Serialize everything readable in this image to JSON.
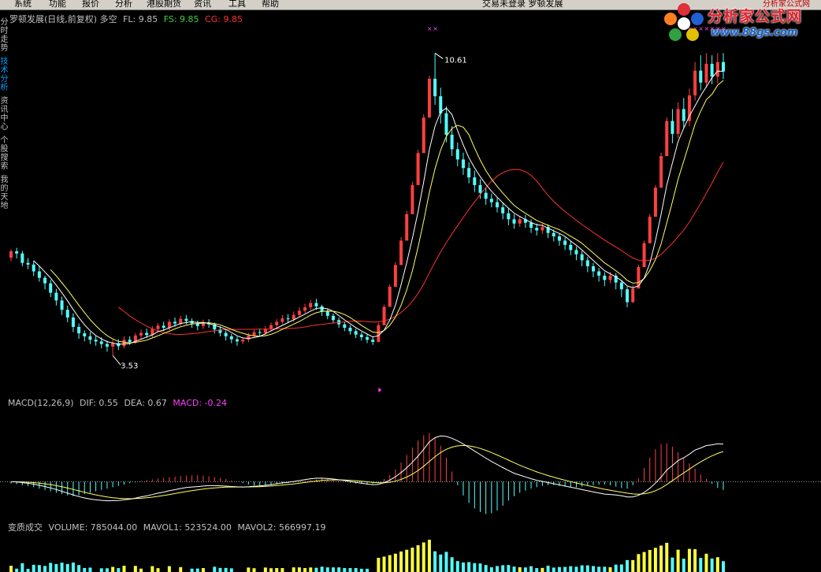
{
  "menubar": {
    "items": [
      "系统",
      "功能",
      "报价",
      "分析",
      "港股期货",
      "资讯",
      "工具",
      "帮助"
    ],
    "right_text": "交易未登录  罗顿发展",
    "right_red": "分析家公式网"
  },
  "sidebar": {
    "items": [
      {
        "label": "分时走势",
        "active": false
      },
      {
        "label": "技术分析",
        "active": true
      },
      {
        "label": "资讯中心",
        "active": false
      },
      {
        "label": "个股搜索",
        "active": false
      },
      {
        "label": "我的天地",
        "active": false
      }
    ]
  },
  "price_header": {
    "title": "罗顿发展(日线,前复权) 多空",
    "fl": "FL: 9.85",
    "fs": "FS: 9.85",
    "cg": "CG: 9.85",
    "colors": {
      "fl": "#c0c0c0",
      "fs": "#40d040",
      "cg": "#ff3030"
    }
  },
  "macd_header": {
    "name": "MACD(12,26,9)",
    "dif": "DIF: 0.55",
    "dea": "DEA: 0.67",
    "macd": "MACD: -0.24",
    "colors": {
      "macd": "#ff40ff"
    }
  },
  "volume_header": {
    "name": "变质成交",
    "volume": "VOLUME: 785044.00",
    "mavol1": "MAVOL1: 523524.00",
    "mavol2": "MAVOL2: 566997.19"
  },
  "logo": {
    "title": "分析家公式网",
    "url": "www.88gs.com"
  },
  "annotations": {
    "high": "10.61",
    "low": "3.53"
  },
  "chart_data": {
    "type": "candlestick",
    "price": {
      "ymin": 3.0,
      "ymax": 11.3,
      "high_marker": 10.61,
      "low_marker": 3.53,
      "candles": [
        [
          5.82,
          5.97,
          6.01,
          5.74
        ],
        [
          5.97,
          5.92,
          6.05,
          5.8
        ],
        [
          5.92,
          5.7,
          5.98,
          5.62
        ],
        [
          5.7,
          5.66,
          5.81,
          5.55
        ],
        [
          5.66,
          5.5,
          5.75,
          5.39
        ],
        [
          5.5,
          5.35,
          5.62,
          5.26
        ],
        [
          5.35,
          5.22,
          5.4,
          5.08
        ],
        [
          5.22,
          5.0,
          5.3,
          4.9
        ],
        [
          5.0,
          4.82,
          5.09,
          4.7
        ],
        [
          4.82,
          4.6,
          4.91,
          4.48
        ],
        [
          4.6,
          4.42,
          4.7,
          4.31
        ],
        [
          4.42,
          4.2,
          4.52,
          4.08
        ],
        [
          4.2,
          4.05,
          4.28,
          3.92
        ],
        [
          4.05,
          3.98,
          4.12,
          3.86
        ],
        [
          3.98,
          3.9,
          4.08,
          3.8
        ],
        [
          3.9,
          3.86,
          3.99,
          3.76
        ],
        [
          3.86,
          3.8,
          3.96,
          3.7
        ],
        [
          3.8,
          3.74,
          3.88,
          3.62
        ],
        [
          3.74,
          3.82,
          3.9,
          3.53
        ],
        [
          3.82,
          3.75,
          3.91,
          3.66
        ],
        [
          3.75,
          3.9,
          3.98,
          3.7
        ],
        [
          3.9,
          3.85,
          3.98,
          3.78
        ],
        [
          3.85,
          4.0,
          4.06,
          3.8
        ],
        [
          4.0,
          4.06,
          4.14,
          3.92
        ],
        [
          4.06,
          4.01,
          4.16,
          3.94
        ],
        [
          4.01,
          4.15,
          4.22,
          3.96
        ],
        [
          4.15,
          4.23,
          4.29,
          4.08
        ],
        [
          4.23,
          4.18,
          4.32,
          4.1
        ],
        [
          4.18,
          4.32,
          4.38,
          4.12
        ],
        [
          4.32,
          4.28,
          4.42,
          4.2
        ],
        [
          4.28,
          4.39,
          4.46,
          4.22
        ],
        [
          4.39,
          4.34,
          4.48,
          4.26
        ],
        [
          4.34,
          4.28,
          4.4,
          4.18
        ],
        [
          4.28,
          4.22,
          4.35,
          4.12
        ],
        [
          4.22,
          4.3,
          4.37,
          4.15
        ],
        [
          4.3,
          4.26,
          4.38,
          4.18
        ],
        [
          4.26,
          4.14,
          4.3,
          4.05
        ],
        [
          4.14,
          4.06,
          4.22,
          3.98
        ],
        [
          4.06,
          3.98,
          4.12,
          3.88
        ],
        [
          3.98,
          3.91,
          4.04,
          3.82
        ],
        [
          3.91,
          3.86,
          3.97,
          3.76
        ],
        [
          3.86,
          3.9,
          3.96,
          3.8
        ],
        [
          3.9,
          4.0,
          4.06,
          3.84
        ],
        [
          4.0,
          4.08,
          4.14,
          3.94
        ],
        [
          4.08,
          4.06,
          4.16,
          3.98
        ],
        [
          4.06,
          4.16,
          4.22,
          4.0
        ],
        [
          4.16,
          4.24,
          4.3,
          4.1
        ],
        [
          4.24,
          4.32,
          4.38,
          4.16
        ],
        [
          4.32,
          4.4,
          4.48,
          4.26
        ],
        [
          4.4,
          4.38,
          4.5,
          4.3
        ],
        [
          4.38,
          4.48,
          4.56,
          4.32
        ],
        [
          4.48,
          4.58,
          4.66,
          4.42
        ],
        [
          4.58,
          4.66,
          4.74,
          4.52
        ],
        [
          4.66,
          4.76,
          4.83,
          4.6
        ],
        [
          4.76,
          4.68,
          4.86,
          4.6
        ],
        [
          4.68,
          4.56,
          4.72,
          4.46
        ],
        [
          4.56,
          4.46,
          4.62,
          4.38
        ],
        [
          4.46,
          4.36,
          4.52,
          4.28
        ],
        [
          4.36,
          4.26,
          4.42,
          4.18
        ],
        [
          4.26,
          4.18,
          4.32,
          4.1
        ],
        [
          4.18,
          4.1,
          4.24,
          4.02
        ],
        [
          4.1,
          4.02,
          4.16,
          3.94
        ],
        [
          4.02,
          3.96,
          4.08,
          3.88
        ],
        [
          3.96,
          3.9,
          4.02,
          3.82
        ],
        [
          3.9,
          3.85,
          3.96,
          3.78
        ],
        [
          3.85,
          4.24,
          4.3,
          3.84
        ],
        [
          4.24,
          4.67,
          4.72,
          4.24
        ],
        [
          4.67,
          5.14,
          5.2,
          4.67
        ],
        [
          5.14,
          5.65,
          5.72,
          5.14
        ],
        [
          5.65,
          6.22,
          6.3,
          5.65
        ],
        [
          6.22,
          6.84,
          6.92,
          6.22
        ],
        [
          6.84,
          7.52,
          7.6,
          6.84
        ],
        [
          7.52,
          8.27,
          8.35,
          7.52
        ],
        [
          8.27,
          9.1,
          9.18,
          8.27
        ],
        [
          9.1,
          10.01,
          10.08,
          9.1
        ],
        [
          10.01,
          9.6,
          10.61,
          9.4
        ],
        [
          9.6,
          9.2,
          9.8,
          8.96
        ],
        [
          9.2,
          8.7,
          9.36,
          8.52
        ],
        [
          8.7,
          8.36,
          8.9,
          8.2
        ],
        [
          8.36,
          8.12,
          8.52,
          7.96
        ],
        [
          8.12,
          7.92,
          8.28,
          7.76
        ],
        [
          7.92,
          7.7,
          8.06,
          7.56
        ],
        [
          7.7,
          7.52,
          7.86,
          7.36
        ],
        [
          7.52,
          7.34,
          7.66,
          7.2
        ],
        [
          7.34,
          7.2,
          7.46,
          7.06
        ],
        [
          7.2,
          7.12,
          7.32,
          7.0
        ],
        [
          7.12,
          7.0,
          7.22,
          6.88
        ],
        [
          7.0,
          6.86,
          7.1,
          6.72
        ],
        [
          6.86,
          6.72,
          6.98,
          6.58
        ],
        [
          6.72,
          6.62,
          6.84,
          6.5
        ],
        [
          6.62,
          6.72,
          6.8,
          6.54
        ],
        [
          6.72,
          6.64,
          6.82,
          6.52
        ],
        [
          6.64,
          6.52,
          6.72,
          6.4
        ],
        [
          6.52,
          6.46,
          6.62,
          6.34
        ],
        [
          6.46,
          6.54,
          6.62,
          6.38
        ],
        [
          6.54,
          6.4,
          6.6,
          6.28
        ],
        [
          6.4,
          6.32,
          6.48,
          6.2
        ],
        [
          6.32,
          6.22,
          6.38,
          6.1
        ],
        [
          6.22,
          6.12,
          6.3,
          6.0
        ],
        [
          6.12,
          6.0,
          6.2,
          5.88
        ],
        [
          6.0,
          5.9,
          6.08,
          5.76
        ],
        [
          5.9,
          5.76,
          5.98,
          5.62
        ],
        [
          5.76,
          5.62,
          5.84,
          5.48
        ],
        [
          5.62,
          5.5,
          5.7,
          5.36
        ],
        [
          5.5,
          5.4,
          5.58,
          5.26
        ],
        [
          5.4,
          5.3,
          5.48,
          5.16
        ],
        [
          5.3,
          5.4,
          5.48,
          5.22
        ],
        [
          5.4,
          5.24,
          5.46,
          5.08
        ],
        [
          5.24,
          5.08,
          5.3,
          4.9
        ],
        [
          5.08,
          4.78,
          5.14,
          4.66
        ],
        [
          4.78,
          5.1,
          5.18,
          4.76
        ],
        [
          5.1,
          5.6,
          5.66,
          5.1
        ],
        [
          5.6,
          6.16,
          6.22,
          5.6
        ],
        [
          6.16,
          6.78,
          6.84,
          6.16
        ],
        [
          6.78,
          7.46,
          7.52,
          6.78
        ],
        [
          7.46,
          8.2,
          8.28,
          7.46
        ],
        [
          8.2,
          9.02,
          9.1,
          8.2
        ],
        [
          9.02,
          8.72,
          9.3,
          8.5
        ],
        [
          8.72,
          9.3,
          9.46,
          8.62
        ],
        [
          9.3,
          9.02,
          9.56,
          8.84
        ],
        [
          9.02,
          9.62,
          9.78,
          8.9
        ],
        [
          9.62,
          10.2,
          10.4,
          9.5
        ],
        [
          10.2,
          9.92,
          10.56,
          9.74
        ],
        [
          9.92,
          10.36,
          10.61,
          9.8
        ],
        [
          10.36,
          10.06,
          10.56,
          9.88
        ],
        [
          10.06,
          10.4,
          10.61,
          9.9
        ],
        [
          10.4,
          10.18,
          10.61,
          10.0
        ]
      ]
    },
    "macd": {
      "ymin": -1.0,
      "ymax": 2.1,
      "hist": [
        -0.05,
        -0.07,
        -0.1,
        -0.13,
        -0.16,
        -0.2,
        -0.24,
        -0.28,
        -0.32,
        -0.36,
        -0.4,
        -0.42,
        -0.4,
        -0.36,
        -0.32,
        -0.28,
        -0.24,
        -0.2,
        -0.16,
        -0.12,
        -0.08,
        -0.04,
        -0.02,
        0.02,
        0.05,
        0.07,
        0.09,
        0.11,
        0.13,
        0.15,
        0.17,
        0.18,
        0.19,
        0.19,
        0.18,
        0.16,
        0.14,
        0.11,
        0.08,
        0.04,
        0.0,
        -0.04,
        -0.08,
        -0.11,
        -0.13,
        -0.12,
        -0.1,
        -0.08,
        -0.06,
        -0.04,
        -0.02,
        0.01,
        0.03,
        0.05,
        0.07,
        0.09,
        0.08,
        0.06,
        0.03,
        0.0,
        -0.03,
        -0.05,
        -0.06,
        -0.06,
        -0.06,
        -0.02,
        0.08,
        0.2,
        0.36,
        0.56,
        0.78,
        1.0,
        1.2,
        1.36,
        1.42,
        1.3,
        1.05,
        0.7,
        0.3,
        -0.1,
        -0.4,
        -0.62,
        -0.78,
        -0.88,
        -0.94,
        -0.92,
        -0.84,
        -0.7,
        -0.55,
        -0.42,
        -0.32,
        -0.26,
        -0.2,
        -0.16,
        -0.12,
        -0.1,
        -0.1,
        -0.12,
        -0.14,
        -0.16,
        -0.16,
        -0.14,
        -0.12,
        -0.1,
        -0.08,
        -0.08,
        -0.1,
        -0.14,
        -0.18,
        -0.2,
        -0.1,
        0.1,
        0.4,
        0.7,
        0.95,
        1.1,
        1.12,
        1.02,
        0.86,
        0.7,
        0.54,
        0.38,
        0.22,
        0.08,
        -0.06,
        -0.18,
        -0.24
      ]
    },
    "volume": {
      "ymin": 0,
      "ymax": 1400000
    }
  }
}
